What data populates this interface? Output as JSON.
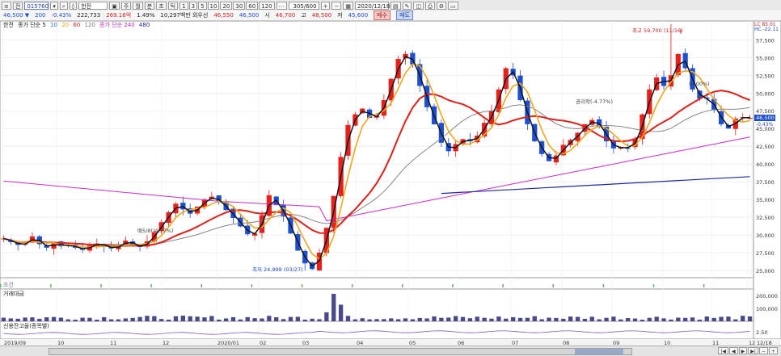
{
  "toolbar": {
    "stock_code": "015760",
    "stock_name": "한전",
    "count": "305/600",
    "date": "2020/12/18",
    "periods": [
      "1",
      "3",
      "5",
      "10",
      "20",
      "30",
      "60",
      "120"
    ],
    "labels": {
      "day": "주",
      "week": "월",
      "month": "분",
      "tick": "초",
      "tick2": "틱"
    }
  },
  "quote": {
    "price": "46,500 ▼",
    "volume_lot": "200",
    "change": "-0.43%",
    "volume": "222,733",
    "amount": "269.16억",
    "ratio": "1.49%",
    "foreign": "10,297백만 외우선",
    "open": "46,550",
    "high_label": "46,500",
    "high_prefix": "시",
    "high_value": "46,700",
    "low_prefix": "고",
    "low_value": "48,500",
    "close_prefix": "저",
    "close_value": "45,600",
    "buy": "매수",
    "sell": "매도"
  },
  "legend": {
    "title": "한전",
    "ma": "종가 단순 5",
    "ma_periods": [
      "10",
      "20",
      "60",
      "120"
    ],
    "ma2": "종가 단순 240",
    "ma2_extra": "480"
  },
  "colors": {
    "up_candle": "#e8201b",
    "down_candle": "#1f4fd1",
    "ma5": "#111111",
    "ma10": "#2a6fe0",
    "ma20": "#f0a81c",
    "ma60": "#e0211a",
    "ma120": "#7a7a7a",
    "ma240": "#d22cc9",
    "ma480": "#1a2aa0",
    "volume": "#4a4a8a",
    "credit": "#7b58c9"
  },
  "annotations": {
    "high": "최고 59,700 (11/16)",
    "low": "최저 24,998 (03/27)",
    "note1": "배5/8(-4.77%)",
    "note2": "권리락(-4.77%)",
    "note3": "(0.00%)",
    "top_right1": "LC 85.01",
    "top_right2": "HC -22.11",
    "last_price": "46,500",
    "last_change": "-0.43%"
  },
  "price_axis": [
    "57,500",
    "55,000",
    "52,500",
    "50,000",
    "47,500",
    "45,000",
    "42,500",
    "40,000",
    "37,500",
    "35,000",
    "32,500",
    "30,000",
    "27,500",
    "25,000"
  ],
  "volume_panel": {
    "label": "거래대금",
    "ticks": [
      "200,000",
      "100,000"
    ]
  },
  "credit_panel": {
    "label": "신용잔고율(종목별)",
    "ticks": [
      "2.50"
    ]
  },
  "empty_panel": {
    "label": "조건"
  },
  "date_axis": [
    "2019/09",
    "10",
    "11",
    "12",
    "2020/01",
    "02",
    "03",
    "04",
    "05",
    "06",
    "07",
    "08",
    "09",
    "10",
    "11",
    "12",
    "12/18"
  ],
  "chart_data": {
    "type": "candlestick",
    "x": "time (2019/09 – 2020/12/18)",
    "ylim": [
      23750,
      59700
    ],
    "close_path": [
      29500,
      29000,
      28600,
      28800,
      29800,
      28700,
      28200,
      28900,
      28400,
      28600,
      28200,
      27900,
      28500,
      28800,
      28400,
      28100,
      28500,
      29200,
      28600,
      28300,
      29100,
      30400,
      31800,
      33200,
      34400,
      33600,
      33000,
      34000,
      35000,
      35400,
      34600,
      33500,
      32400,
      31200,
      30100,
      30200,
      32800,
      35600,
      34200,
      32600,
      30200,
      27800,
      26000,
      25200,
      27500,
      31000,
      35500,
      41000,
      45500,
      47000,
      47800,
      46500,
      46800,
      49000,
      52000,
      54800,
      55500,
      54000,
      51000,
      48000,
      45600,
      43000,
      41800,
      42800,
      43500,
      43200,
      44000,
      45800,
      47500,
      50500,
      53500,
      52500,
      49000,
      45600,
      43200,
      41400,
      40400,
      41200,
      42700,
      43400,
      44400,
      45600,
      46200,
      45200,
      43200,
      42200,
      42400,
      42200,
      43600,
      47000,
      50500,
      52200,
      51000,
      52500,
      55500,
      53500,
      50500,
      49200,
      49200,
      47600,
      45600,
      45000,
      46400,
      46600,
      46500
    ],
    "high_point": {
      "label": "최고",
      "value": 59700,
      "date": "11/16"
    },
    "low_point": {
      "label": "최저",
      "value": 24998,
      "date": "03/27"
    }
  }
}
